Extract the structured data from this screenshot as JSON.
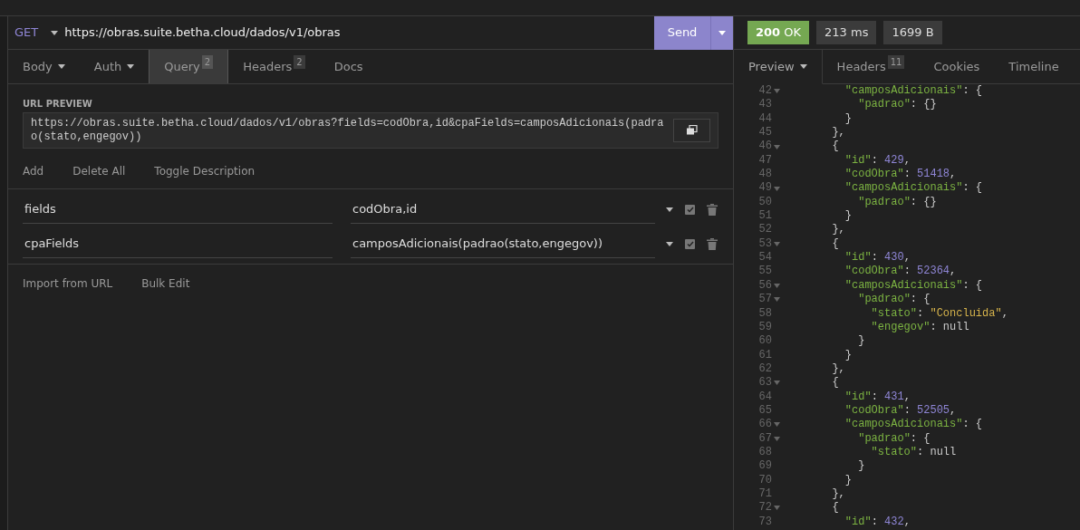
{
  "request": {
    "method": "GET",
    "url": "https://obras.suite.betha.cloud/dados/v1/obras",
    "send": "Send"
  },
  "request_tabs": [
    {
      "label": "Body",
      "dropdown": true,
      "selected": false
    },
    {
      "label": "Auth",
      "dropdown": true,
      "selected": false
    },
    {
      "label": "Query",
      "count": "2",
      "selected": true
    },
    {
      "label": "Headers",
      "count": "2",
      "selected": false
    },
    {
      "label": "Docs",
      "selected": false
    }
  ],
  "url_preview": {
    "label": "URL PREVIEW",
    "text": "https://obras.suite.betha.cloud/dados/v1/obras?fields=codObra,id&cpaFields=camposAdicionais(padrao(stato,engegov))"
  },
  "param_actions": [
    "Add",
    "Delete All",
    "Toggle Description"
  ],
  "params": [
    {
      "name": "fields",
      "value": "codObra,id",
      "enabled": true
    },
    {
      "name": "cpaFields",
      "value": "camposAdicionais(padrao(stato,engegov))",
      "enabled": true
    }
  ],
  "footer_actions": [
    "Import from URL",
    "Bulk Edit"
  ],
  "response": {
    "status": {
      "code": "200",
      "text": "OK"
    },
    "time": "213 ms",
    "size": "1699 B"
  },
  "response_tabs": [
    {
      "label": "Preview",
      "dropdown": true,
      "selected": true
    },
    {
      "label": "Headers",
      "count": "11",
      "selected": false
    },
    {
      "label": "Cookies",
      "selected": false
    },
    {
      "label": "Timeline",
      "selected": false
    }
  ],
  "code_lines": [
    {
      "number": "42",
      "foldable": true,
      "text": "    \"camposAdicionais\": {"
    },
    {
      "number": "43",
      "foldable": false,
      "text": "      \"padrao\": {}"
    },
    {
      "number": "44",
      "foldable": false,
      "text": "    }"
    },
    {
      "number": "45",
      "foldable": false,
      "text": "  },"
    },
    {
      "number": "46",
      "foldable": true,
      "text": "  {"
    },
    {
      "number": "47",
      "foldable": false,
      "text": "    \"id\": 429,"
    },
    {
      "number": "48",
      "foldable": false,
      "text": "    \"codObra\": 51418,"
    },
    {
      "number": "49",
      "foldable": true,
      "text": "    \"camposAdicionais\": {"
    },
    {
      "number": "50",
      "foldable": false,
      "text": "      \"padrao\": {}"
    },
    {
      "number": "51",
      "foldable": false,
      "text": "    }"
    },
    {
      "number": "52",
      "foldable": false,
      "text": "  },"
    },
    {
      "number": "53",
      "foldable": true,
      "text": "  {"
    },
    {
      "number": "54",
      "foldable": false,
      "text": "    \"id\": 430,"
    },
    {
      "number": "55",
      "foldable": false,
      "text": "    \"codObra\": 52364,"
    },
    {
      "number": "56",
      "foldable": true,
      "text": "    \"camposAdicionais\": {"
    },
    {
      "number": "57",
      "foldable": true,
      "text": "      \"padrao\": {"
    },
    {
      "number": "58",
      "foldable": false,
      "text": "        \"stato\": \"Concluida\","
    },
    {
      "number": "59",
      "foldable": false,
      "text": "        \"engegov\": null"
    },
    {
      "number": "60",
      "foldable": false,
      "text": "      }"
    },
    {
      "number": "61",
      "foldable": false,
      "text": "    }"
    },
    {
      "number": "62",
      "foldable": false,
      "text": "  },"
    },
    {
      "number": "63",
      "foldable": true,
      "text": "  {"
    },
    {
      "number": "64",
      "foldable": false,
      "text": "    \"id\": 431,"
    },
    {
      "number": "65",
      "foldable": false,
      "text": "    \"codObra\": 52505,"
    },
    {
      "number": "66",
      "foldable": true,
      "text": "    \"camposAdicionais\": {"
    },
    {
      "number": "67",
      "foldable": true,
      "text": "      \"padrao\": {"
    },
    {
      "number": "68",
      "foldable": false,
      "text": "        \"stato\": null"
    },
    {
      "number": "69",
      "foldable": false,
      "text": "      }"
    },
    {
      "number": "70",
      "foldable": false,
      "text": "    }"
    },
    {
      "number": "71",
      "foldable": false,
      "text": "  },"
    },
    {
      "number": "72",
      "foldable": true,
      "text": "  {"
    },
    {
      "number": "73",
      "foldable": false,
      "text": "    \"id\": 432,"
    }
  ]
}
